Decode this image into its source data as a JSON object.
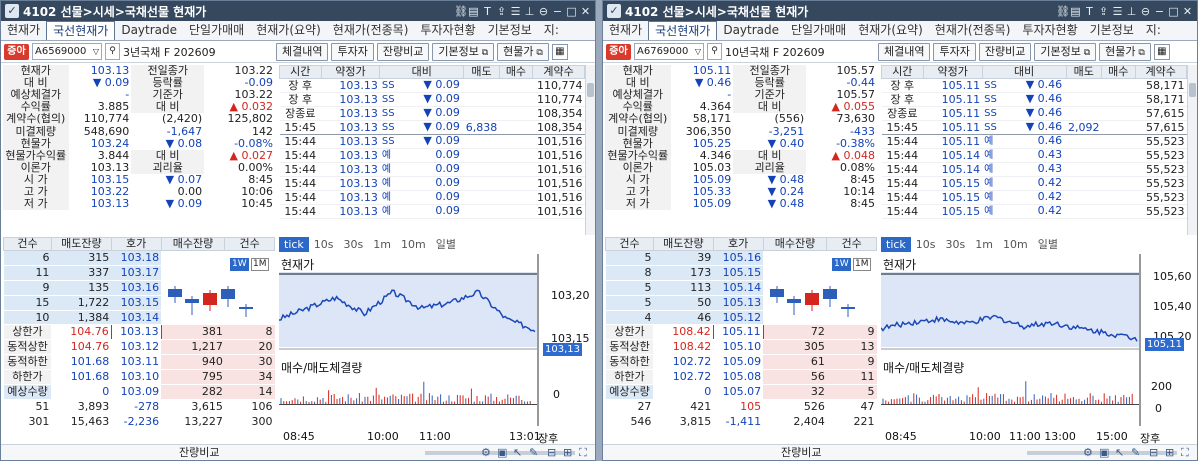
{
  "windows": [
    {
      "title": "4102 선물>시세>국채선물 현재가",
      "tabs": [
        "현재가",
        "국선현재가",
        "Daytrade",
        "단일가매매",
        "현재가(요약)",
        "현재가(전종목)",
        "투자자현황",
        "기본정보",
        "지:"
      ],
      "active_tab": 1,
      "logo": "증아",
      "code": "A6569000",
      "item_name": "3년국채 F 202609",
      "buttons": [
        "체결내역",
        "투자자",
        "잔량비교",
        "기본정보",
        "현물가"
      ],
      "quote_rows": [
        [
          "현재가",
          "103.13",
          "전일종가",
          "103.22"
        ],
        [
          "대 비",
          "▼ 0.09",
          "등락률",
          "-0.09"
        ],
        [
          "예상체결가",
          "-",
          "기준가",
          "103.22"
        ],
        [
          "수익률",
          "3.885",
          "대 비",
          "▲ 0.032"
        ],
        [
          "계약수(협의)",
          "110,774",
          "(2,420)",
          "125,802"
        ],
        [
          "미결제량",
          "548,690",
          "-1,647",
          "142"
        ],
        [
          "현물가",
          "103.24",
          "▼ 0.08",
          "-0.08%"
        ],
        [
          "현물가수익률",
          "3.844",
          "대 비",
          "▲ 0.027"
        ],
        [
          "이론가",
          "103.13",
          "괴리율",
          "0.00%"
        ],
        [
          "시 가",
          "103.15",
          "▼ 0.07",
          "8:45"
        ],
        [
          "고 가",
          "103.22",
          "0.00",
          "10:06"
        ],
        [
          "저 가",
          "103.13",
          "▼ 0.09",
          "10:45"
        ]
      ],
      "trade_headers": [
        "시간",
        "약정가",
        "대비",
        "매도",
        "매수",
        "계약수"
      ],
      "trades": [
        [
          "장 후",
          "103.13",
          "SS",
          "▼ 0.09",
          "",
          "",
          "110,774"
        ],
        [
          "장 후",
          "103.13",
          "SS",
          "▼ 0.09",
          "",
          "",
          "110,774"
        ],
        [
          "장종료",
          "103.13",
          "SS",
          "▼ 0.09",
          "",
          "",
          "108,354"
        ],
        [
          "15:45",
          "103.13",
          "SS",
          "▼ 0.09",
          "6,838",
          "",
          "108,354"
        ],
        [
          "15:44",
          "103.13",
          "SS",
          "▼ 0.09",
          "",
          "",
          "101,516"
        ],
        [
          "15:44",
          "103.13",
          "예",
          "0.09",
          "",
          "",
          "101,516"
        ],
        [
          "15:44",
          "103.13",
          "예",
          "0.09",
          "",
          "",
          "101,516"
        ],
        [
          "15:44",
          "103.13",
          "예",
          "0.09",
          "",
          "",
          "101,516"
        ],
        [
          "15:44",
          "103.13",
          "예",
          "0.09",
          "",
          "",
          "101,516"
        ],
        [
          "15:44",
          "103.13",
          "예",
          "0.09",
          "",
          "",
          "101,516"
        ]
      ],
      "ob_headers": [
        "건수",
        "매도잔량",
        "호가",
        "매수잔량",
        "건수"
      ],
      "ob_rows": [
        [
          "6",
          "315",
          "103.18",
          "",
          ""
        ],
        [
          "11",
          "337",
          "103.17",
          "",
          ""
        ],
        [
          "9",
          "135",
          "103.16",
          "",
          ""
        ],
        [
          "15",
          "1,722",
          "103.15",
          "",
          ""
        ],
        [
          "10",
          "1,384",
          "103.14",
          "",
          ""
        ],
        [
          "상한가",
          "104.76",
          "103.13",
          "381",
          "8"
        ],
        [
          "동적상한",
          "104.76",
          "103.12",
          "1,217",
          "20"
        ],
        [
          "동적하한",
          "101.68",
          "103.11",
          "940",
          "30"
        ],
        [
          "하한가",
          "101.68",
          "103.10",
          "795",
          "34"
        ],
        [
          "예상수량",
          "0",
          "103.09",
          "282",
          "14"
        ],
        [
          "51",
          "3,893",
          "-278",
          "3,615",
          "106"
        ],
        [
          "301",
          "15,463",
          "-2,236",
          "13,227",
          "300"
        ]
      ],
      "footer_label": "잔량비교",
      "chart_tabs": [
        "tick",
        "10s",
        "30s",
        "1m",
        "10m",
        "일별"
      ],
      "chart_label": "현재가",
      "vol_label": "매수/매도체결량",
      "wm": [
        "1W",
        "1M"
      ],
      "price_ticks": [
        "103,20",
        "103,15"
      ],
      "last_price": "103,13",
      "vol_tick": "0",
      "time_ticks": [
        "08:45",
        "10:00",
        "11:00",
        "13:01",
        "장후"
      ],
      "chart_data": {
        "type": "line",
        "title": "현재가",
        "x": [
          "08:45",
          "10:00",
          "11:00",
          "13:01",
          "장후"
        ],
        "ylim": [
          103.1,
          103.23
        ],
        "series": [
          {
            "name": "현재가",
            "values": [
              103.15,
              103.17,
              103.19,
              103.16,
              103.2,
              103.17,
              103.18,
              103.2,
              103.15,
              103.13
            ]
          }
        ]
      }
    },
    {
      "title": "4102 선물>시세>국채선물 현재가",
      "tabs": [
        "현재가",
        "국선현재가",
        "Daytrade",
        "단일가매매",
        "현재가(요약)",
        "현재가(전종목)",
        "투자자현황",
        "기본정보",
        "지:"
      ],
      "active_tab": 1,
      "logo": "증아",
      "code": "A6769000",
      "item_name": "10년국채 F 202609",
      "buttons": [
        "체결내역",
        "투자자",
        "잔량비교",
        "기본정보",
        "현물가"
      ],
      "quote_rows": [
        [
          "현재가",
          "105.11",
          "전일종가",
          "105.57"
        ],
        [
          "대 비",
          "▼ 0.46",
          "등락률",
          "-0.44"
        ],
        [
          "예상체결가",
          "-",
          "기준가",
          "105.57"
        ],
        [
          "수익률",
          "4.364",
          "대 비",
          "▲ 0.055"
        ],
        [
          "계약수(협의)",
          "58,171",
          "(556)",
          "73,630"
        ],
        [
          "미결제량",
          "306,350",
          "-3,251",
          "-433"
        ],
        [
          "현물가",
          "105.25",
          "▼ 0.40",
          "-0.38%"
        ],
        [
          "현물가수익률",
          "4.346",
          "대 비",
          "▲ 0.048"
        ],
        [
          "이론가",
          "105.03",
          "괴리율",
          "0.08%"
        ],
        [
          "시 가",
          "105.09",
          "▼ 0.48",
          "8:45"
        ],
        [
          "고 가",
          "105.33",
          "▼ 0.24",
          "10:14"
        ],
        [
          "저 가",
          "105.09",
          "▼ 0.48",
          "8:45"
        ]
      ],
      "trade_headers": [
        "시간",
        "약정가",
        "대비",
        "매도",
        "매수",
        "계약수"
      ],
      "trades": [
        [
          "장 후",
          "105.11",
          "SS",
          "▼ 0.46",
          "",
          "",
          "58,171"
        ],
        [
          "장 후",
          "105.11",
          "SS",
          "▼ 0.46",
          "",
          "",
          "58,171"
        ],
        [
          "장종료",
          "105.11",
          "SS",
          "▼ 0.46",
          "",
          "",
          "57,615"
        ],
        [
          "15:45",
          "105.11",
          "SS",
          "▼ 0.46",
          "2,092",
          "",
          "57,615"
        ],
        [
          "15:44",
          "105.11",
          "예",
          "0.46",
          "",
          "",
          "55,523"
        ],
        [
          "15:44",
          "105.14",
          "예",
          "0.43",
          "",
          "",
          "55,523"
        ],
        [
          "15:44",
          "105.14",
          "예",
          "0.43",
          "",
          "",
          "55,523"
        ],
        [
          "15:44",
          "105.15",
          "예",
          "0.42",
          "",
          "",
          "55,523"
        ],
        [
          "15:44",
          "105.15",
          "예",
          "0.42",
          "",
          "",
          "55,523"
        ],
        [
          "15:44",
          "105.15",
          "예",
          "0.42",
          "",
          "",
          "55,523"
        ]
      ],
      "ob_headers": [
        "건수",
        "매도잔량",
        "호가",
        "매수잔량",
        "건수"
      ],
      "ob_rows": [
        [
          "5",
          "39",
          "105.16",
          "",
          ""
        ],
        [
          "8",
          "173",
          "105.15",
          "",
          ""
        ],
        [
          "5",
          "113",
          "105.14",
          "",
          ""
        ],
        [
          "5",
          "50",
          "105.13",
          "",
          ""
        ],
        [
          "4",
          "46",
          "105.12",
          "",
          ""
        ],
        [
          "상한가",
          "108.42",
          "105.11",
          "72",
          "9"
        ],
        [
          "동적상한",
          "108.42",
          "105.10",
          "305",
          "13"
        ],
        [
          "동적하한",
          "102.72",
          "105.09",
          "61",
          "9"
        ],
        [
          "하한가",
          "102.72",
          "105.08",
          "56",
          "11"
        ],
        [
          "예상수량",
          "0",
          "105.07",
          "32",
          "5"
        ],
        [
          "27",
          "421",
          "105",
          "526",
          "47"
        ],
        [
          "546",
          "3,815",
          "-1,411",
          "2,404",
          "221"
        ]
      ],
      "footer_label": "잔량비교",
      "chart_tabs": [
        "tick",
        "10s",
        "30s",
        "1m",
        "10m",
        "일별"
      ],
      "chart_label": "현재가",
      "vol_label": "매수/매도체결량",
      "wm": [
        "1W",
        "1M"
      ],
      "price_ticks": [
        "105,60",
        "105,40",
        "105,20"
      ],
      "last_price": "105,11",
      "vol_tick": "200",
      "vol_tick2": "0",
      "time_ticks": [
        "08:45",
        "10:00",
        "11:00 13:00",
        "15:00",
        "장후"
      ],
      "chart_data": {
        "type": "line",
        "title": "현재가",
        "x": [
          "08:45",
          "10:00",
          "11:00",
          "13:00",
          "15:00",
          "장후"
        ],
        "ylim": [
          105.05,
          105.65
        ],
        "series": [
          {
            "name": "현재가",
            "values": [
              105.2,
              105.25,
              105.28,
              105.24,
              105.3,
              105.22,
              105.25,
              105.2,
              105.16,
              105.11
            ]
          }
        ]
      }
    }
  ]
}
